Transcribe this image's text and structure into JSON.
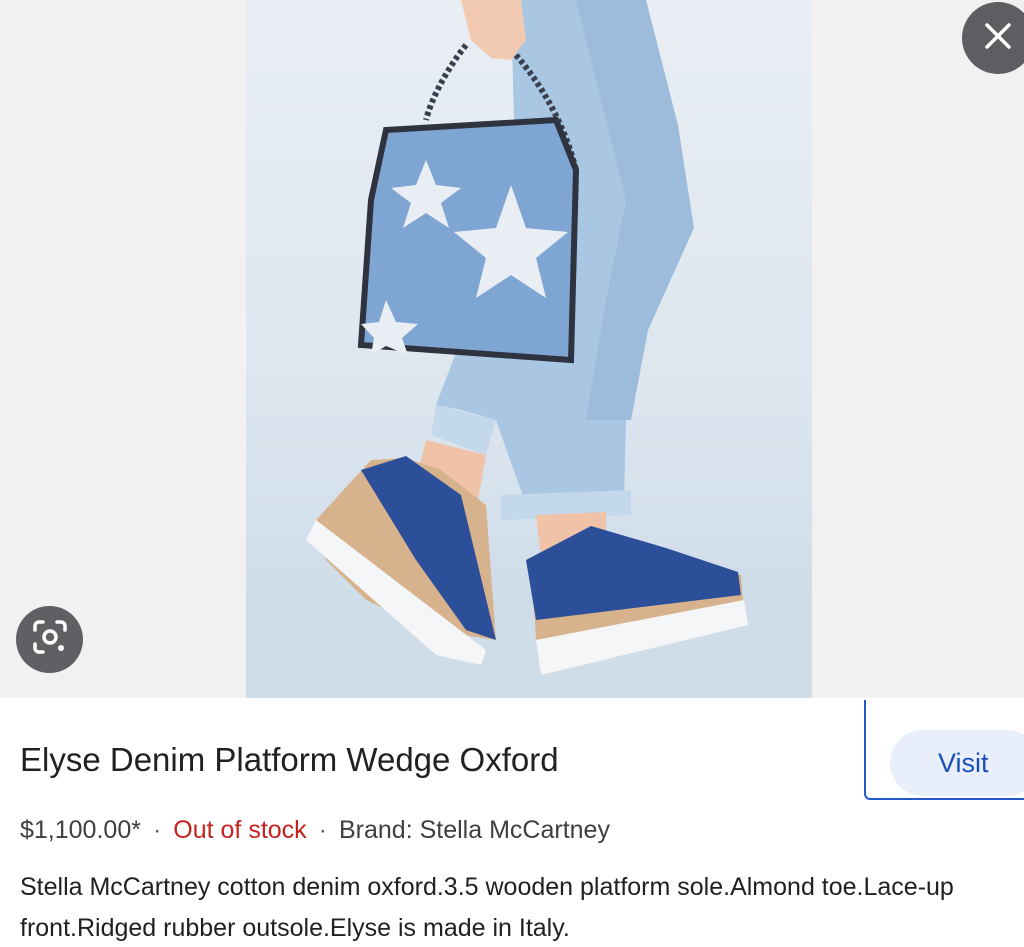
{
  "product": {
    "title": "Elyse Denim Platform Wedge Oxford",
    "price": "$1,100.00*",
    "separator": "·",
    "stock_status": "Out of stock",
    "brand": "Brand: Stella McCartney",
    "description": "Stella McCartney cotton denim oxford.3.5 wooden platform sole.Almond toe.Lace-up front.Ridged rubber outsole.Elyse is made in Italy."
  },
  "actions": {
    "visit_label": "Visit"
  },
  "icons": {
    "close": "close-icon",
    "lens": "lens-icon"
  },
  "colors": {
    "accent": "#2559c9",
    "out_of_stock": "#c5221f",
    "visit_bg": "#e8eefa"
  }
}
